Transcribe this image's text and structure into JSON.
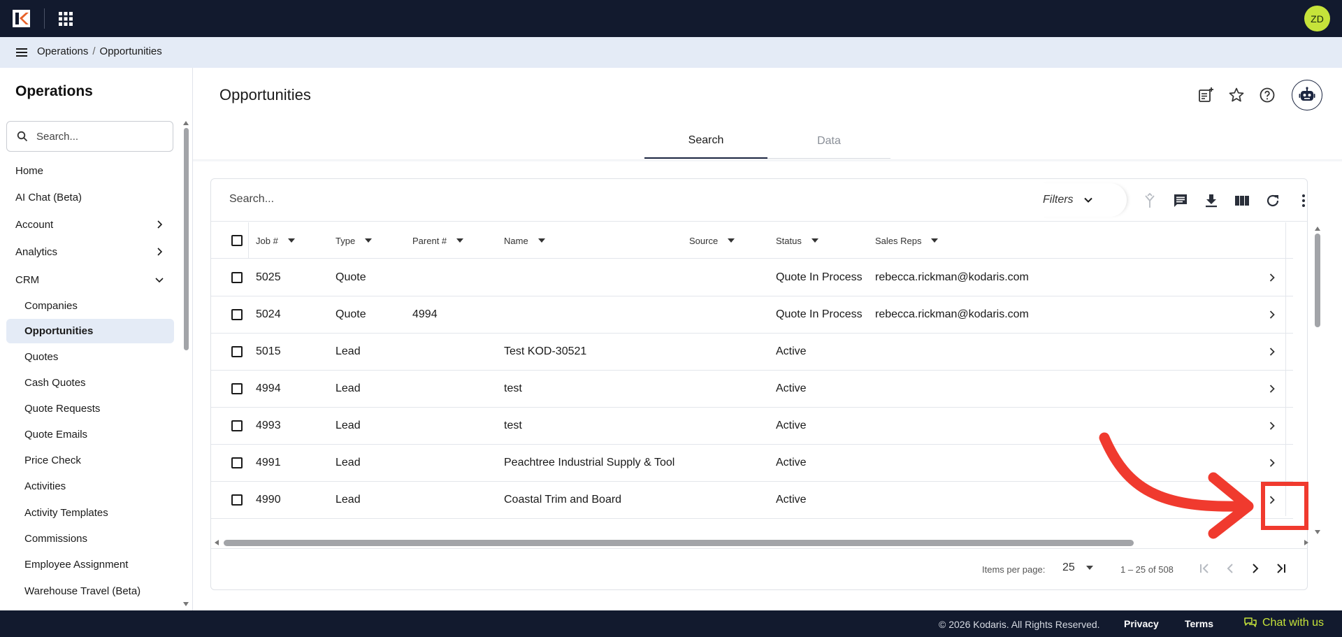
{
  "app": {
    "avatar_initials": "ZD",
    "accent_color": "#c6e33a",
    "topbar_color": "#121a2e"
  },
  "breadcrumb": {
    "items": [
      "Operations",
      "Opportunities"
    ],
    "separator": "/"
  },
  "sidebar": {
    "title": "Operations",
    "search_placeholder": "Search...",
    "items": [
      {
        "label": "Home",
        "level": "top"
      },
      {
        "label": "AI Chat (Beta)",
        "level": "top"
      },
      {
        "label": "Account",
        "level": "top",
        "chevron": "chevron-right-icon"
      },
      {
        "label": "Analytics",
        "level": "top",
        "chevron": "chevron-right-icon"
      },
      {
        "label": "CRM",
        "level": "top",
        "chevron": "chevron-down-icon"
      },
      {
        "label": "Companies",
        "level": "sub"
      },
      {
        "label": "Opportunities",
        "level": "sub",
        "active": true
      },
      {
        "label": "Quotes",
        "level": "sub"
      },
      {
        "label": "Cash Quotes",
        "level": "sub"
      },
      {
        "label": "Quote Requests",
        "level": "sub"
      },
      {
        "label": "Quote Emails",
        "level": "sub"
      },
      {
        "label": "Price Check",
        "level": "sub"
      },
      {
        "label": "Activities",
        "level": "sub"
      },
      {
        "label": "Activity Templates",
        "level": "sub"
      },
      {
        "label": "Commissions",
        "level": "sub"
      },
      {
        "label": "Employee Assignment",
        "level": "sub"
      },
      {
        "label": "Warehouse Travel (Beta)",
        "level": "sub"
      }
    ]
  },
  "page": {
    "title": "Opportunities",
    "tabs": [
      {
        "label": "Search",
        "active": true
      },
      {
        "label": "Data",
        "active": false
      }
    ]
  },
  "table": {
    "search_placeholder": "Search...",
    "filters_label": "Filters",
    "columns": [
      "Job #",
      "Type",
      "Parent #",
      "Name",
      "Source",
      "Status",
      "Sales Reps"
    ],
    "rows": [
      {
        "job": "5025",
        "type": "Quote",
        "parent": "",
        "name": "",
        "source": "",
        "status": "Quote In Process",
        "sales_reps": "rebecca.rickman@kodaris.com"
      },
      {
        "job": "5024",
        "type": "Quote",
        "parent": "4994",
        "name": "",
        "source": "",
        "status": "Quote In Process",
        "sales_reps": "rebecca.rickman@kodaris.com"
      },
      {
        "job": "5015",
        "type": "Lead",
        "parent": "",
        "name": "Test KOD-30521",
        "source": "",
        "status": "Active",
        "sales_reps": ""
      },
      {
        "job": "4994",
        "type": "Lead",
        "parent": "",
        "name": "test",
        "source": "",
        "status": "Active",
        "sales_reps": ""
      },
      {
        "job": "4993",
        "type": "Lead",
        "parent": "",
        "name": "test",
        "source": "",
        "status": "Active",
        "sales_reps": ""
      },
      {
        "job": "4991",
        "type": "Lead",
        "parent": "",
        "name": "Peachtree Industrial Supply & Tool",
        "source": "",
        "status": "Active",
        "sales_reps": ""
      },
      {
        "job": "4990",
        "type": "Lead",
        "parent": "",
        "name": "Coastal Trim and Board",
        "source": "",
        "status": "Active",
        "sales_reps": ""
      }
    ]
  },
  "paginator": {
    "items_per_page_label": "Items per page:",
    "page_size": "25",
    "range_label": "1 – 25 of 508"
  },
  "annotation": {
    "color": "#f03a2e"
  },
  "footer": {
    "copyright": "© 2026 Kodaris. All Rights Reserved.",
    "privacy": "Privacy",
    "terms": "Terms",
    "chat": "Chat with us"
  }
}
